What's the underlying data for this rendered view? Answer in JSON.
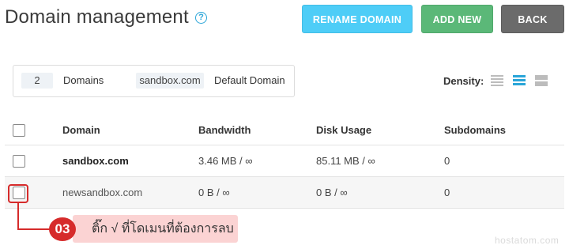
{
  "header": {
    "title": "Domain management",
    "help_icon": "?"
  },
  "toolbar": {
    "rename_label": "RENAME DOMAIN",
    "add_label": "ADD NEW",
    "back_label": "BACK"
  },
  "summary": {
    "count": "2",
    "domains_label": "Domains",
    "default_domain": "sandbox.com",
    "default_label": "Default Domain"
  },
  "density": {
    "label": "Density:",
    "options": [
      "compact-density-icon",
      "normal-density-icon",
      "comfortable-density-icon"
    ],
    "selected": "normal-density-icon"
  },
  "table": {
    "columns": [
      "Domain",
      "Bandwidth",
      "Disk Usage",
      "Subdomains"
    ],
    "rows": [
      {
        "domain": "sandbox.com",
        "bandwidth": "3.46 MB / ∞",
        "disk_usage": "85.11 MB / ∞",
        "subdomains": "0"
      },
      {
        "domain": "newsandbox.com",
        "bandwidth": "0 B / ∞",
        "disk_usage": "0 B / ∞",
        "subdomains": "0"
      }
    ]
  },
  "callout": {
    "number": "03",
    "text": "ติ๊ก √ ที่โดเมนที่ต้องการลบ"
  },
  "watermark": "hostatom.com",
  "colors": {
    "rename": "#4ecdf7",
    "add": "#5bb878",
    "back": "#6b6b6b",
    "accent": "#2aa5d8",
    "callout": "#d62b2b"
  }
}
